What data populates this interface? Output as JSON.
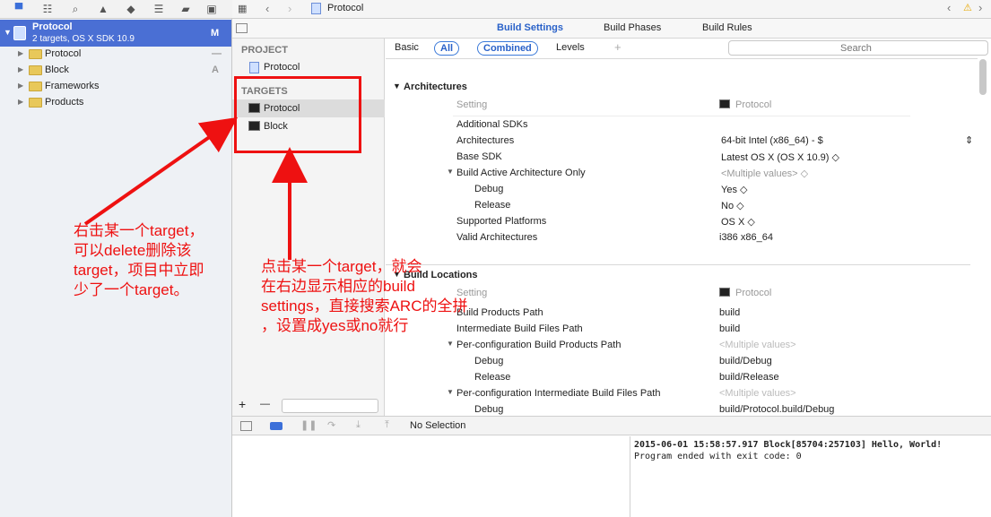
{
  "navigator": {
    "project": {
      "name": "Protocol",
      "subtitle": "2 targets, OS X SDK 10.9",
      "badge": "M"
    },
    "items": [
      {
        "label": "Protocol",
        "badge": "—"
      },
      {
        "label": "Block",
        "badge": "A"
      },
      {
        "label": "Frameworks",
        "badge": ""
      },
      {
        "label": "Products",
        "badge": ""
      }
    ]
  },
  "topbar": {
    "breadcrumb": "Protocol"
  },
  "tabs": {
    "build_settings": "Build Settings",
    "build_phases": "Build Phases",
    "build_rules": "Build Rules"
  },
  "targets_panel": {
    "project_header": "PROJECT",
    "project_item": "Protocol",
    "targets_header": "TARGETS",
    "targets": [
      "Protocol",
      "Block"
    ],
    "add": "+",
    "remove": "—"
  },
  "filters": {
    "basic": "Basic",
    "all": "All",
    "combined": "Combined",
    "levels": "Levels",
    "add": "+",
    "search_placeholder": "Search"
  },
  "architectures": {
    "title": "Architectures",
    "setting_header": "Setting",
    "target_header": "Protocol",
    "rows": [
      {
        "key": "Additional SDKs",
        "value": ""
      },
      {
        "key": "Architectures",
        "value": "64-bit Intel (x86_64)  -  $"
      },
      {
        "key": "Base SDK",
        "value": "Latest OS X (OS X 10.9) ◇"
      },
      {
        "key": "Build Active Architecture Only",
        "value": "<Multiple values> ◇"
      },
      {
        "key": "Debug",
        "value": "Yes ◇"
      },
      {
        "key": "Release",
        "value": "No ◇"
      },
      {
        "key": "Supported Platforms",
        "value": "OS X ◇"
      },
      {
        "key": "Valid Architectures",
        "value": "i386 x86_64"
      }
    ]
  },
  "build_locations": {
    "title": "Build Locations",
    "setting_header": "Setting",
    "target_header": "Protocol",
    "rows": [
      {
        "key": "Build Products Path",
        "value": "build"
      },
      {
        "key": "Intermediate Build Files Path",
        "value": "build"
      },
      {
        "key": "Per-configuration Build Products Path",
        "value": "<Multiple values>"
      },
      {
        "key": "Debug",
        "value": "build/Debug"
      },
      {
        "key": "Release",
        "value": "build/Release"
      },
      {
        "key": "Per-configuration Intermediate Build Files Path",
        "value": "<Multiple values>"
      },
      {
        "key": "Debug",
        "value": "build/Protocol.build/Debug"
      }
    ]
  },
  "debug_bar": {
    "selection": "No Selection"
  },
  "console": {
    "line1": "2015-06-01 15:58:57.917 Block[85704:257103] Hello, World!",
    "line2": "Program ended with exit code: 0"
  },
  "annotations": {
    "left_note": [
      "右击某一个target，",
      "可以delete删除该",
      "target，项目中立即",
      "少了一个target。"
    ],
    "center_note": [
      "点击某一个target，就会",
      "在右边显示相应的build",
      "settings，直接搜索ARC的全拼",
      "，设置成yes或no就行"
    ]
  },
  "colors": {
    "selection": "#4a6fd4",
    "annotation": "#ee1111",
    "accent": "#2a62c9"
  }
}
